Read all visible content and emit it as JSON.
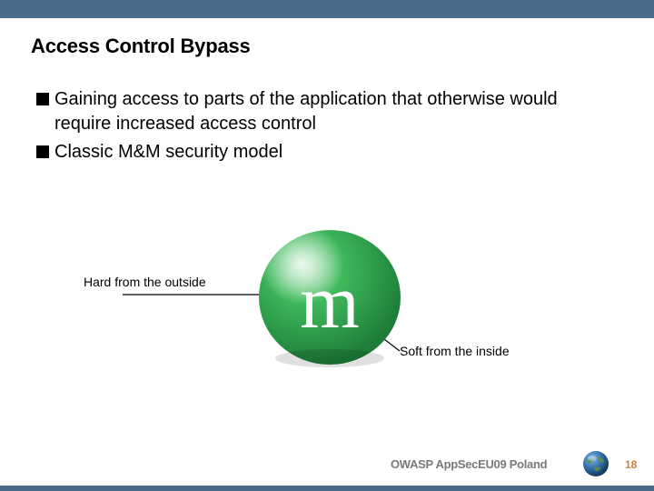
{
  "title": "Access Control Bypass",
  "bullets": [
    "Gaining access to parts of the application that otherwise would require increased access control",
    "Classic M&M security model"
  ],
  "labels": {
    "hard": "Hard from the outside",
    "soft": "Soft from the inside"
  },
  "candy": {
    "letter": "m",
    "shell_color": "#2aa14a",
    "shell_highlight": "#6fc97f",
    "letter_color": "#ffffff"
  },
  "footer": {
    "text": "OWASP AppSecEU09 Poland",
    "page": "18"
  }
}
